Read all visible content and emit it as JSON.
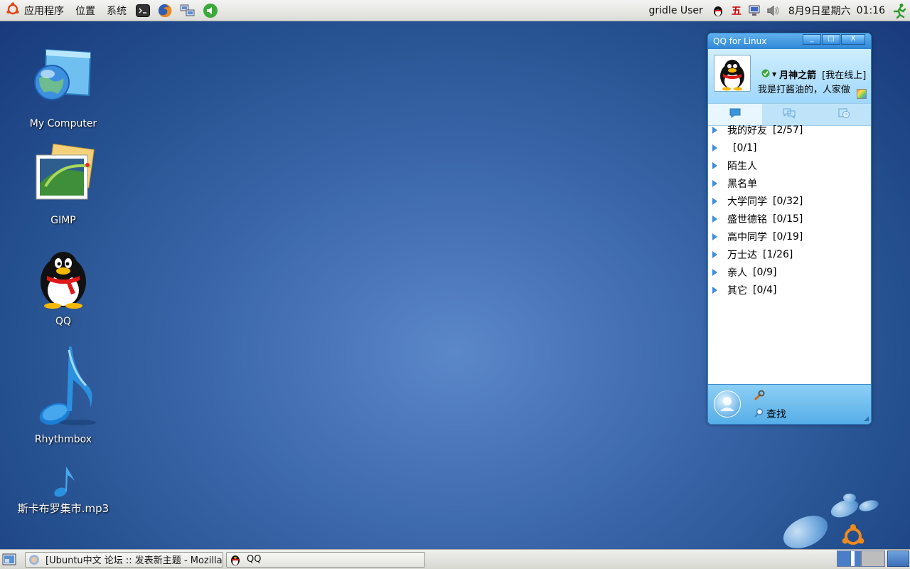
{
  "top_panel": {
    "menus": [
      "应用程序",
      "位置",
      "系统"
    ],
    "launchers": [
      "terminal-icon",
      "firefox-icon",
      "network-icon",
      "sound-launcher-icon"
    ],
    "user": "gridle User",
    "tray_icons": [
      "qq-tray-icon",
      "input-method-icon",
      "network-status-icon",
      "volume-icon"
    ],
    "input_method_label": "五",
    "date": "8月9日星期六",
    "time": "01:16"
  },
  "desktop_icons": [
    {
      "label": "My Computer",
      "icon": "my-computer-icon"
    },
    {
      "label": "GIMP",
      "icon": "gimp-icon"
    },
    {
      "label": "QQ",
      "icon": "qq-penguin-icon"
    },
    {
      "label": "Rhythmbox",
      "icon": "rhythmbox-icon"
    },
    {
      "label": "斯卡布罗集市.mp3",
      "icon": "mp3-file-icon"
    }
  ],
  "qq_window": {
    "title": "QQ for Linux",
    "window_buttons": [
      "_",
      "□",
      "X"
    ],
    "nickname": "月神之箭",
    "status": "[我在线上]",
    "signature": "我是打酱油的，人家做",
    "groups": [
      {
        "name": "我的好友",
        "count": "[2/57]"
      },
      {
        "name": "",
        "count": "[0/1]"
      },
      {
        "name": "陌生人",
        "count": ""
      },
      {
        "name": "黑名单",
        "count": ""
      },
      {
        "name": "大学同学",
        "count": "[0/32]"
      },
      {
        "name": "盛世德铭",
        "count": "[0/15]"
      },
      {
        "name": "高中同学",
        "count": "[0/19]"
      },
      {
        "name": "万士达",
        "count": "[1/26]"
      },
      {
        "name": "亲人",
        "count": "[0/9]"
      },
      {
        "name": "其它",
        "count": "[0/4]"
      }
    ],
    "find_label": "查找"
  },
  "taskbar": {
    "tasks": [
      {
        "label": "[Ubuntu中文 论坛 :: 发表新主题 - Mozilla Firefox]",
        "icon": "firefox-icon"
      },
      {
        "label": "QQ",
        "icon": "qq-penguin-icon"
      }
    ]
  }
}
